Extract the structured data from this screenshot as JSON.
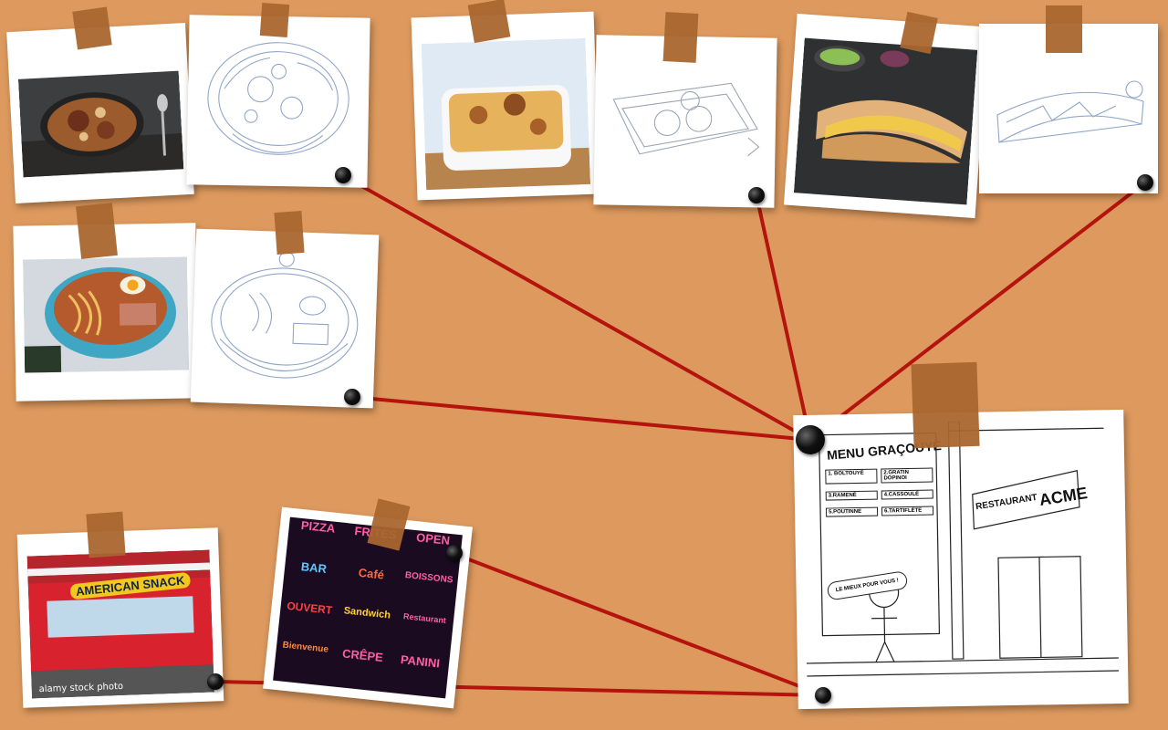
{
  "board": {
    "photos": {
      "casserole_photo": {
        "alt": "casserole dish photo"
      },
      "gratin_photo": {
        "alt": "gratin dish photo"
      },
      "sandwich_photo": {
        "alt": "fries sandwich photo"
      },
      "ramen_photo": {
        "alt": "ramen bowl photo"
      }
    },
    "storefront": {
      "sign": "AMERICAN SNACK",
      "watermark": "alamy stock photo"
    },
    "neon_signs": [
      "PIZZA",
      "FRITES",
      "OPEN",
      "BAR",
      "Café",
      "BOISSONS",
      "OUVERT",
      "Sandwich",
      "Restaurant",
      "Bienvenue",
      "CRÊPE",
      "PANINI"
    ],
    "scene": {
      "menu_title": "MENU GRAÇOUYÈ",
      "menu_items": [
        "1. BOLTOUYÉ",
        "2.GRATIN DOPINOI",
        "3.RAMENÉ",
        "4.CASSOULÉ",
        "5.POUTINNE",
        "6.TARTIFLÉTE"
      ],
      "speech": "LE MIEUX POUR VOUS !",
      "restaurant_label": "RESTAURANT",
      "brand": "ACME"
    },
    "colors": {
      "background": "#de9a5e",
      "tape": "#a9662f",
      "string": "#b4140d",
      "pin": "#000000"
    }
  }
}
